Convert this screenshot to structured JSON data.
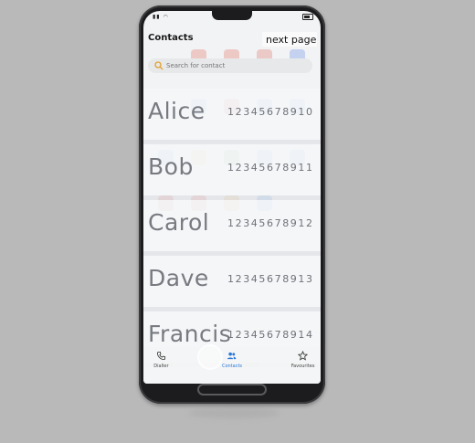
{
  "screen": {
    "title": "Contacts",
    "next_page_label": "next page"
  },
  "search": {
    "placeholder": "Search for contact"
  },
  "contacts": [
    {
      "name": "Alice",
      "number": "12345678910"
    },
    {
      "name": "Bob",
      "number": "12345678911"
    },
    {
      "name": "Carol",
      "number": "12345678912"
    },
    {
      "name": "Dave",
      "number": "12345678913"
    },
    {
      "name": "Francis",
      "number": "12345678914"
    }
  ],
  "tabs": {
    "dialler": "Dialler",
    "contacts": "Contacts",
    "favourites": "Favourites"
  },
  "icons": {
    "search": "search-icon",
    "dialler": "phone-icon",
    "contacts": "people-icon",
    "favourites": "star-icon"
  },
  "colors": {
    "accent": "#2a78d8",
    "contact_text": "#777a80"
  }
}
